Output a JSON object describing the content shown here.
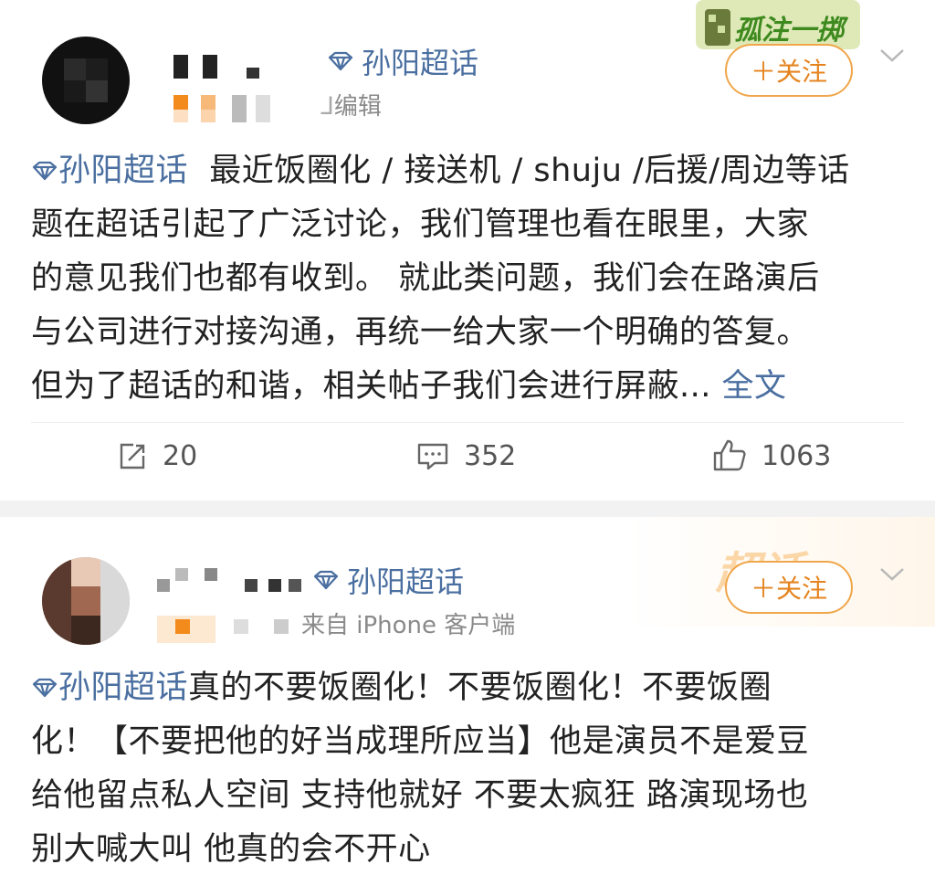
{
  "posts": [
    {
      "supertopic": "孙阳超话",
      "meta": "编辑",
      "follow_label": "＋关注",
      "badge_text": "孤注一掷",
      "body_tag": "孙阳超话",
      "body_lines": [
        "最近饭圈化 / 接送机 / shuju /后援/周边等话",
        "题在超话引起了广泛讨论，我们管理也看在眼里，大家",
        "的意见我们也都有收到。 就此类问题，我们会在路演后",
        "与公司进行对接沟通，再统一给大家一个明确的答复。",
        "但为了超话的和谐，相关帖子我们会进行屏蔽..."
      ],
      "more_label": "全文",
      "repost_count": "20",
      "comment_count": "352",
      "like_count": "1063"
    },
    {
      "supertopic": "孙阳超话",
      "meta": "来自 iPhone 客户端",
      "follow_label": "＋关注",
      "badge_text": "超话",
      "body_tag": "孙阳超话",
      "body_lines": [
        "真的不要饭圈化！不要饭圈化！不要饭圈",
        "化！【不要把他的好当成理所应当】他是演员不是爱豆",
        "给他留点私人空间 支持他就好 不要太疯狂 路演现场也",
        "别大喊大叫 他真的会不开心"
      ]
    }
  ],
  "colors": {
    "topic_blue": "#4a6fa0",
    "follow_orange": "#e5841f",
    "divider": "#ececec"
  },
  "icons": [
    "diamond-icon",
    "repost-icon",
    "comment-icon",
    "like-icon",
    "chevron-down-icon"
  ]
}
